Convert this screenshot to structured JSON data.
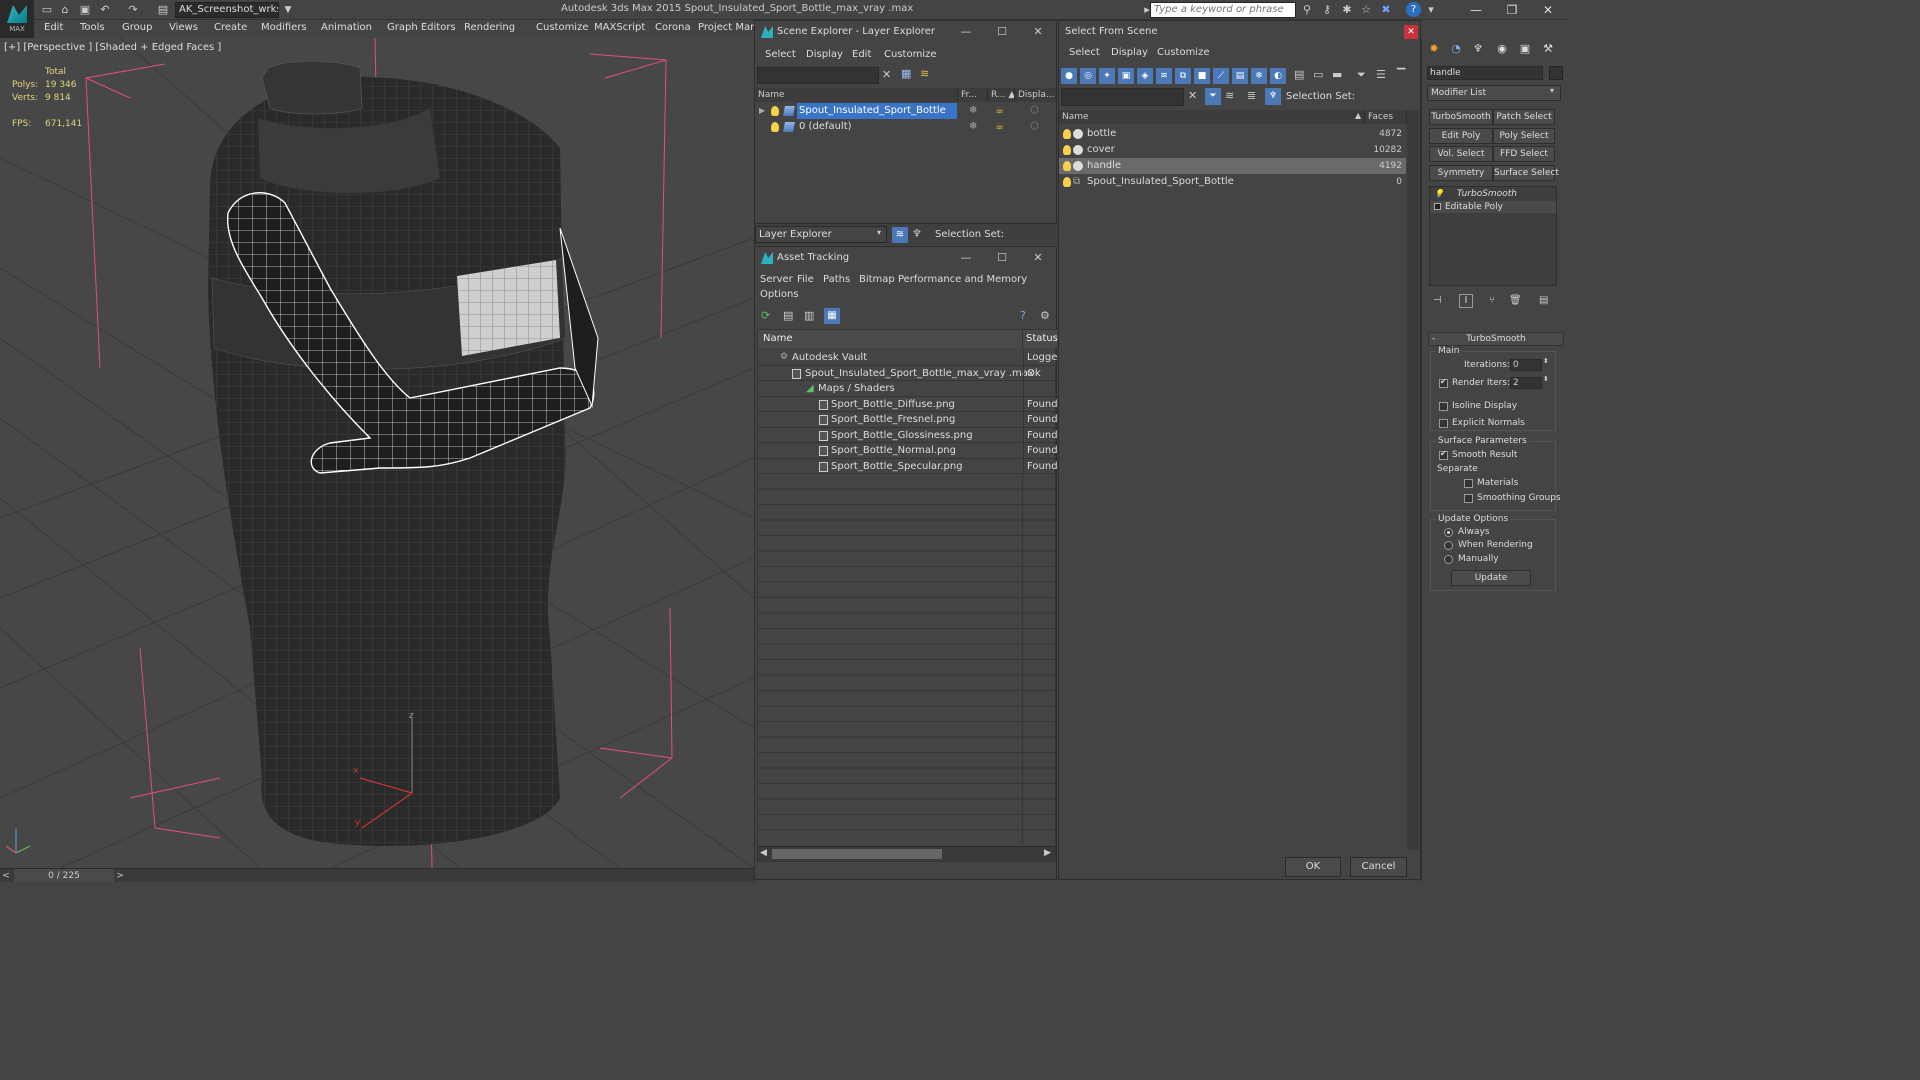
{
  "titlebar": {
    "app_title": "Autodesk 3ds Max  2015      Spout_Insulated_Sport_Bottle_max_vray  .max",
    "workspace": "AK_Screenshot_wrksp",
    "search_placeholder": "Type a keyword or phrase",
    "logo_text": "MAX",
    "help_glyph": "?",
    "quick_access_icons": [
      "new-file-icon",
      "open-file-icon",
      "save-icon",
      "undo-icon",
      "redo-icon",
      "project-folder-icon"
    ],
    "tool_icons": [
      "binoculars-icon",
      "key-icon",
      "satellite-icon",
      "star-icon",
      "x-icon"
    ],
    "window_controls": {
      "minimize": "—",
      "restore": "❐",
      "close": "✕"
    }
  },
  "menubar": [
    "Edit",
    "Tools",
    "Group",
    "Views",
    "Create",
    "Modifiers",
    "Animation",
    "Graph Editors",
    "Rendering",
    "Customize",
    "MAXScript",
    "Corona",
    "Project Man"
  ],
  "viewport": {
    "label": "[+] [Perspective ] [Shaded + Edged Faces ]",
    "stats": {
      "total_label": "Total",
      "polys_label": "Polys:",
      "polys": "19 346",
      "verts_label": "Verts:",
      "verts": "9 814",
      "fps_label": "FPS:",
      "fps": "671,141"
    },
    "axis_labels": {
      "x": "x",
      "y": "y",
      "z": "z"
    }
  },
  "timeline": {
    "frame": "0 / 225",
    "prev": "<",
    "next": ">"
  },
  "scene_explorer": {
    "title": "Scene Explorer - Layer Explorer",
    "menus": [
      "Select",
      "Display",
      "Edit",
      "Customize"
    ],
    "columns": [
      "Name",
      "Fr...",
      "R... ▲",
      "Displa..."
    ],
    "rows": [
      {
        "name": "Spout_Insulated_Sport_Bottle",
        "selected": true
      },
      {
        "name": "0 (default)",
        "selected": false
      }
    ],
    "footer_label": "Layer Explorer",
    "selection_set_label": "Selection Set:"
  },
  "asset_tracking": {
    "title": "Asset Tracking",
    "menus": [
      "Server",
      "File",
      "Paths",
      "Bitmap Performance and Memory",
      "Options"
    ],
    "columns": [
      "Name",
      "Status"
    ],
    "rows": [
      {
        "name": "Autodesk Vault",
        "status": "Logged",
        "indent": 1
      },
      {
        "name": "Spout_Insulated_Sport_Bottle_max_vray  .max",
        "status": "Ok",
        "indent": 2
      },
      {
        "name": "Maps / Shaders",
        "status": "",
        "indent": 3
      },
      {
        "name": "Sport_Bottle_Diffuse.png",
        "status": "Found",
        "indent": 4
      },
      {
        "name": "Sport_Bottle_Fresnel.png",
        "status": "Found",
        "indent": 4
      },
      {
        "name": "Sport_Bottle_Glossiness.png",
        "status": "Found",
        "indent": 4
      },
      {
        "name": "Sport_Bottle_Normal.png",
        "status": "Found",
        "indent": 4
      },
      {
        "name": "Sport_Bottle_Specular.png",
        "status": "Found",
        "indent": 4
      }
    ]
  },
  "select_from_scene": {
    "title": "Select From Scene",
    "menus": [
      "Select",
      "Display",
      "Customize"
    ],
    "selection_set_label": "Selection Set:",
    "columns": [
      "Name",
      "Faces"
    ],
    "rows": [
      {
        "name": "bottle",
        "faces": "4872",
        "selected": false
      },
      {
        "name": "cover",
        "faces": "10282",
        "selected": false
      },
      {
        "name": "handle",
        "faces": "4192",
        "selected": true
      },
      {
        "name": "Spout_Insulated_Sport_Bottle",
        "faces": "0",
        "selected": false
      }
    ],
    "ok_label": "OK",
    "cancel_label": "Cancel"
  },
  "command_panel": {
    "object_name": "handle",
    "modifier_list_label": "Modifier List",
    "modifier_buttons": [
      "TurboSmooth",
      "Patch Select",
      "Edit Poly",
      "Poly Select",
      "Vol. Select",
      "FFD Select",
      "Symmetry",
      "Surface Select"
    ],
    "stack": [
      "TurboSmooth",
      "Editable Poly"
    ],
    "rollout_title": "TurboSmooth",
    "main_label": "Main",
    "iterations_label": "Iterations:",
    "iterations": "0",
    "render_iters_label": "Render Iters:",
    "render_iters": "2",
    "isoline_label": "Isoline Display",
    "explicit_normals_label": "Explicit Normals",
    "surface_params_label": "Surface Parameters",
    "smooth_result_label": "Smooth Result",
    "separate_label": "Separate",
    "materials_label": "Materials",
    "smoothing_groups_label": "Smoothing Groups",
    "update_options_label": "Update Options",
    "always_label": "Always",
    "when_rendering_label": "When Rendering",
    "manually_label": "Manually",
    "update_button": "Update"
  },
  "colors": {
    "selection_blue": "#3a74c7",
    "stats_yellow": "#e3d47a",
    "bounding_pink": "#e0507a",
    "wire_white": "#ffffff"
  }
}
